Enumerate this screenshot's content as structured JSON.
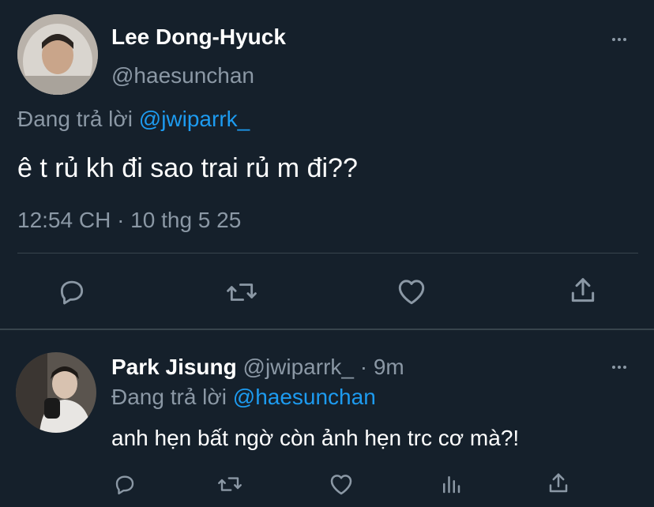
{
  "main_tweet": {
    "display_name": "Lee Dong-Hyuck",
    "handle": "@haesunchan",
    "reply_prefix": "Đang trả lời",
    "reply_to": "@jwiparrk_",
    "text": "ê t rủ kh đi sao trai rủ m đi??",
    "timestamp": "12:54 CH · 10 thg 5 25"
  },
  "reply_tweet": {
    "display_name": "Park Jisung",
    "handle": "@jwiparrk_",
    "separator": "·",
    "time": "9m",
    "reply_prefix": "Đang trả lời",
    "reply_to": "@haesunchan",
    "text": "anh hẹn bất ngờ còn ảnh hẹn trc cơ mà?!"
  },
  "icons": {
    "reply": "reply-icon",
    "retweet": "retweet-icon",
    "like": "heart-icon",
    "share": "share-icon",
    "analytics": "analytics-icon",
    "more": "more-icon"
  },
  "colors": {
    "background": "#15202b",
    "text": "#ffffff",
    "muted": "#8b98a5",
    "accent": "#1d9bf0",
    "divider": "#38444d"
  }
}
